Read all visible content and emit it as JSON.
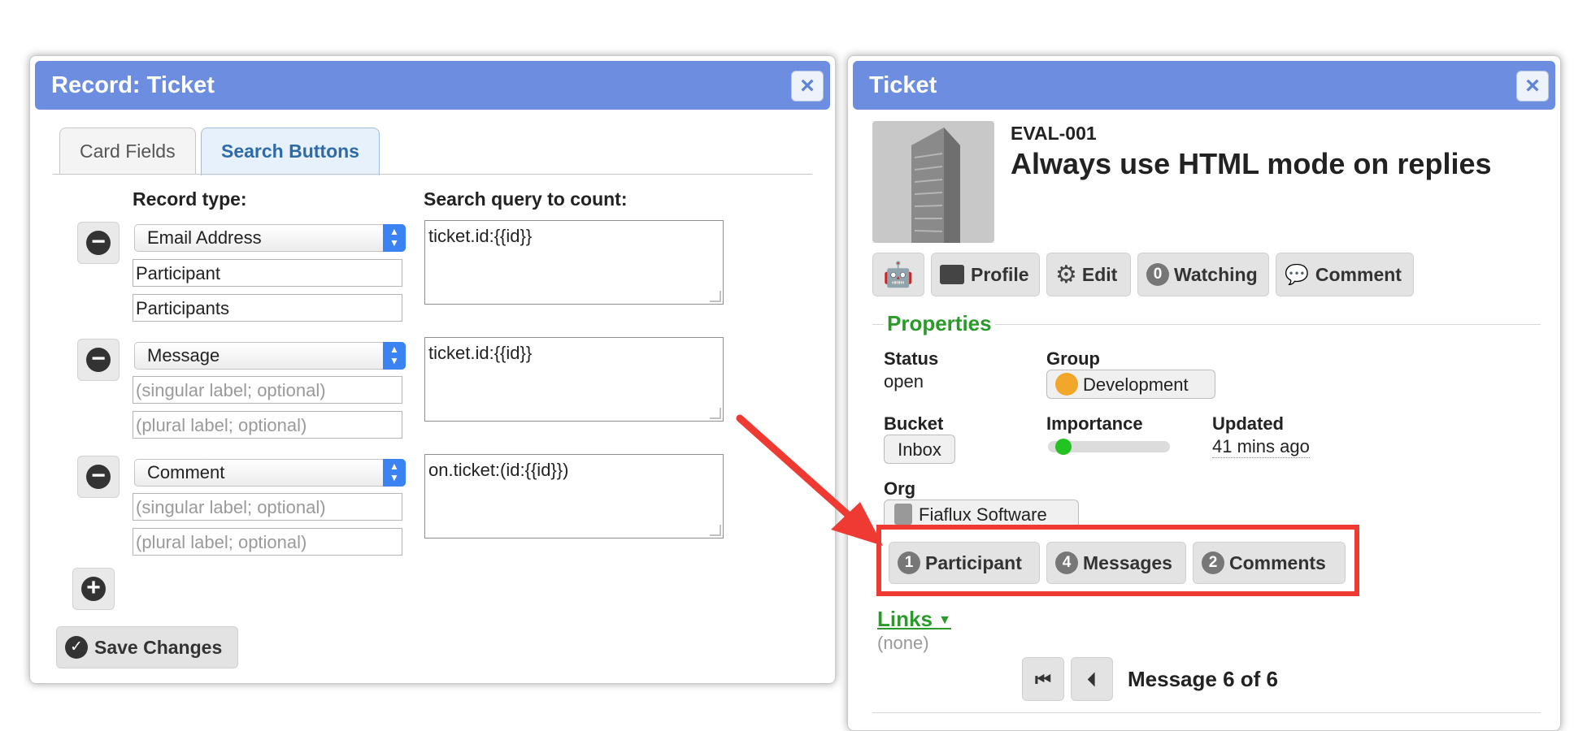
{
  "left_dialog": {
    "title": "Record: Ticket",
    "close_icon": "close-icon",
    "tabs": [
      {
        "label": "Card Fields",
        "active": false
      },
      {
        "label": "Search Buttons",
        "active": true
      }
    ],
    "col_record_type": "Record type:",
    "col_search_query": "Search query to count:",
    "rows": [
      {
        "record_type": "Email Address",
        "singular": "Participant",
        "plural": "Participants",
        "query": "ticket.id:{{id}}"
      },
      {
        "record_type": "Message",
        "singular_placeholder": "(singular label; optional)",
        "plural_placeholder": "(plural label; optional)",
        "query": "ticket.id:{{id}}"
      },
      {
        "record_type": "Comment",
        "singular_placeholder": "(singular label; optional)",
        "plural_placeholder": "(plural label; optional)",
        "query": "on.ticket:(id:{{id}})"
      }
    ],
    "save_label": "Save Changes"
  },
  "right_dialog": {
    "title": "Ticket",
    "ticket_id": "EVAL-001",
    "ticket_subject": "Always use HTML mode on replies",
    "toolbar": {
      "profile": "Profile",
      "edit": "Edit",
      "watching_count": "0",
      "watching": "Watching",
      "comment": "Comment"
    },
    "properties_title": "Properties",
    "status_label": "Status",
    "status_value": "open",
    "group_label": "Group",
    "group_value": "Development",
    "bucket_label": "Bucket",
    "bucket_value": "Inbox",
    "importance_label": "Importance",
    "importance_level": 0.07,
    "updated_label": "Updated",
    "updated_value": "41 mins ago",
    "org_label": "Org",
    "org_value": "Fiaflux Software",
    "search_buttons": [
      {
        "count": "1",
        "label": "Participant"
      },
      {
        "count": "4",
        "label": "Messages"
      },
      {
        "count": "2",
        "label": "Comments"
      }
    ],
    "links_title": "Links",
    "links_value": "(none)",
    "message_nav": "Message 6 of 6"
  },
  "colors": {
    "titlebar": "#6d8ee0",
    "accent_green": "#2a9a2a",
    "highlight_red": "#ef3a33",
    "importance_dot": "#22c322"
  }
}
